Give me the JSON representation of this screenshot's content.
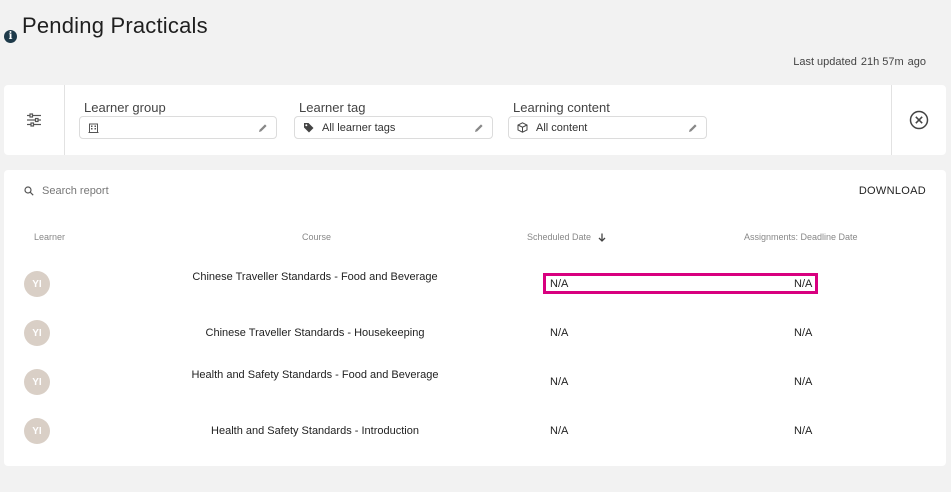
{
  "page": {
    "title": "Pending Practicals",
    "info_icon": "info-icon",
    "last_updated_label": "Last updated",
    "last_updated_value": "21h 57m",
    "last_updated_suffix": "ago"
  },
  "filters": {
    "toggle_icon": "sliders-icon",
    "items": [
      {
        "label": "Learner group",
        "value": "",
        "icon": "building-icon"
      },
      {
        "label": "Learner tag",
        "value": "All learner tags",
        "icon": "tag-icon"
      },
      {
        "label": "Learning content",
        "value": "All content",
        "icon": "cube-icon"
      }
    ],
    "clear_icon": "close-circle-icon"
  },
  "report": {
    "search_placeholder": "Search report",
    "download_label": "DOWNLOAD",
    "columns": {
      "learner": "Learner",
      "course": "Course",
      "scheduled": "Scheduled Date",
      "deadline": "Assignments: Deadline Date"
    },
    "rows": [
      {
        "initials": "YI",
        "course": "Chinese Traveller Standards - Food and Beverage",
        "scheduled": "N/A",
        "deadline": "N/A"
      },
      {
        "initials": "YI",
        "course": "Chinese Traveller Standards - Housekeeping",
        "scheduled": "N/A",
        "deadline": "N/A"
      },
      {
        "initials": "YI",
        "course": "Health and Safety Standards - Food and Beverage",
        "scheduled": "N/A",
        "deadline": "N/A"
      },
      {
        "initials": "YI",
        "course": "Health and Safety Standards - Introduction",
        "scheduled": "N/A",
        "deadline": "N/A"
      }
    ]
  },
  "colors": {
    "highlight": "#d8007f",
    "avatar_bg": "#d9cfc6"
  }
}
